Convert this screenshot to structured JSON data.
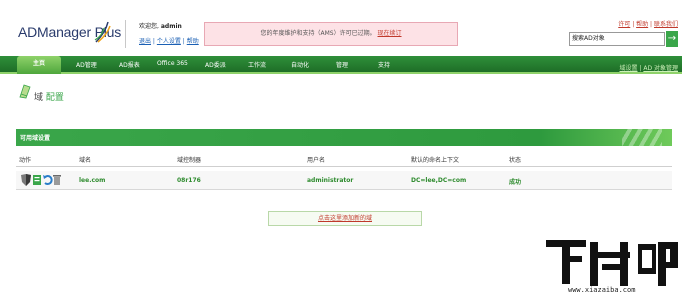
{
  "header": {
    "logo_text": "ADManager Plus",
    "welcome_prefix": "欢迎您,",
    "username": "admin",
    "user_links": [
      "退出",
      "个人设置",
      "帮助"
    ],
    "alert_text": "您的年度维护和支持（AMS）许可已过期。",
    "alert_link": "现在续订",
    "top_links": [
      "许可",
      "帮助",
      "联系我们"
    ],
    "search_placeholder": "搜索AD对象",
    "search_go": "→"
  },
  "nav": {
    "tabs": [
      "主页",
      "AD管理",
      "AD报表",
      "Office 365",
      "AD委派",
      "工作流",
      "自动化",
      "管理",
      "支持"
    ],
    "active_index": 0,
    "right_links": [
      "域设置",
      "AD 对象管理"
    ]
  },
  "breadcrumb": {
    "part1": "域",
    "part2": "配置"
  },
  "panel": {
    "title": "可用域设置",
    "columns": [
      "动作",
      "域名",
      "域控制器",
      "用户名",
      "默认的命名上下文",
      "状态"
    ],
    "rows": [
      {
        "domain": "lee.com",
        "dc": "08r176",
        "user": "administrator",
        "context": "DC=lee,DC=com",
        "status": "成功"
      }
    ],
    "add_button": "点击这里添加新的域"
  },
  "watermark": {
    "brand": "下载吧",
    "url": "www.xiazaiba.com"
  },
  "colors": {
    "accent_green": "#3aa64a",
    "nav_green": "#2f8f3a",
    "alert_bg": "#fde2e6",
    "link_red": "#c0392b"
  }
}
